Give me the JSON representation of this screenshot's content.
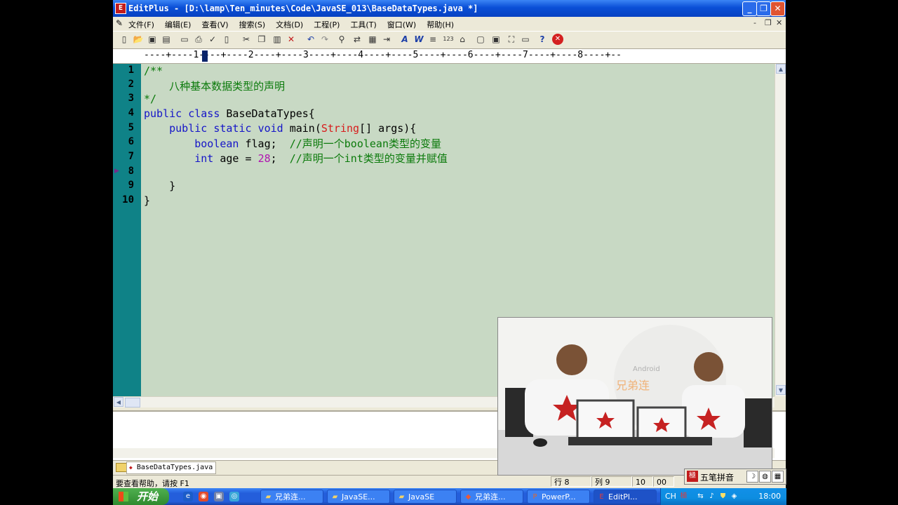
{
  "window": {
    "app_icon": "E",
    "title": "EditPlus - [D:\\lamp\\Ten_minutes\\Code\\JavaSE_013\\BaseDataTypes.java *]",
    "buttons": {
      "minimize": "_",
      "maximize": "❐",
      "close": "✕"
    }
  },
  "menu": {
    "items": [
      "文件(F)",
      "编辑(E)",
      "查看(V)",
      "搜索(S)",
      "文档(D)",
      "工程(P)",
      "工具(T)",
      "窗口(W)",
      "帮助(H)"
    ],
    "mdi": {
      "minimize": "-",
      "restore": "❐",
      "close": "✕"
    }
  },
  "toolbar": {
    "icons": [
      "new-file",
      "open-folder",
      "save",
      "save-all",
      "print-preview",
      "print",
      "spell-check",
      "new-page",
      "cut",
      "copy",
      "paste",
      "delete",
      "undo",
      "redo",
      "find",
      "replace",
      "find-in-files",
      "indent",
      "font",
      "word-wrap",
      "line-numbers",
      "ruler",
      "toggle-view",
      "hex",
      "column",
      "fullscreen",
      "window",
      "help",
      "close"
    ]
  },
  "ruler": {
    "text": "----+----1----+----2----+----3----+----4----+----5----+----6----+----7----+----8----+--"
  },
  "editor": {
    "line_numbers": [
      "1",
      "2",
      "3",
      "4",
      "5",
      "6",
      "7",
      "8",
      "9",
      "10"
    ],
    "current_line": 8
  },
  "code": {
    "l1": "/**",
    "l2": "    八种基本数据类型的声明",
    "l3": "*/",
    "l4_kw1": "public",
    "l4_kw2": "class",
    "l4_rest": " BaseDataTypes{",
    "l5_indent": "    ",
    "l5_kw1": "public",
    "l5_kw2": "static",
    "l5_kw3": "void",
    "l5_name": " main(",
    "l5_type": "String",
    "l5_rest": "[] args){",
    "l6_indent": "        ",
    "l6_kw": "boolean",
    "l6_rest": " flag;  ",
    "l6_comment": "//声明一个boolean类型的变量",
    "l7_indent": "        ",
    "l7_kw": "int",
    "l7_rest": " age = ",
    "l7_num": "28",
    "l7_rest2": ";  ",
    "l7_comment": "//声明一个int类型的变量并赋值",
    "l9": "    }",
    "l10": "}"
  },
  "file_tabs": {
    "active": "BaseDataTypes.java"
  },
  "status": {
    "help": "要查看帮助，请按 F1",
    "line_label": "行 8",
    "col_label": "列 9",
    "f1": "10",
    "f2": "00"
  },
  "ime": {
    "name": "五笔拼音"
  },
  "webcam": {
    "brand_cn": "兄弟连",
    "brand_en": "Android"
  },
  "taskbar": {
    "start": "开始",
    "tasks": [
      "兄弟连...",
      "JavaSE...",
      "JavaSE",
      "兄弟连...",
      "PowerP...",
      "EditPl..."
    ],
    "active_task": 5,
    "lang": "CH",
    "clock": "18:00"
  },
  "colors": {
    "editor_bg": "#c8d9c4",
    "gutter_bg": "#0f8287",
    "comment": "#0b7a0b",
    "keyword": "#1515c8",
    "type": "#d81c1c",
    "number": "#b014b0",
    "titlebar": "#0a4fd6"
  }
}
